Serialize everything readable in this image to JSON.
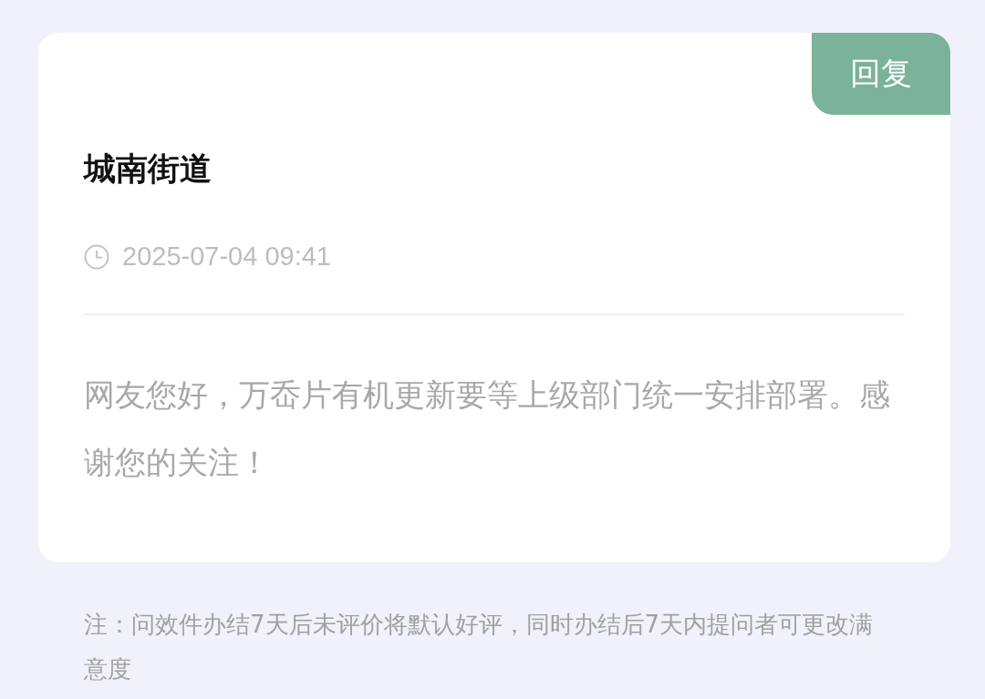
{
  "card": {
    "badge": "回复",
    "title": "城南街道",
    "time": "2025-07-04 09:41",
    "reply": "网友您好，万岙片有机更新要等上级部门统一安排部署。感谢您的关注！"
  },
  "note": "注：问效件办结7天后未评价将默认好评，同时办结后7天内提问者可更改满意度"
}
